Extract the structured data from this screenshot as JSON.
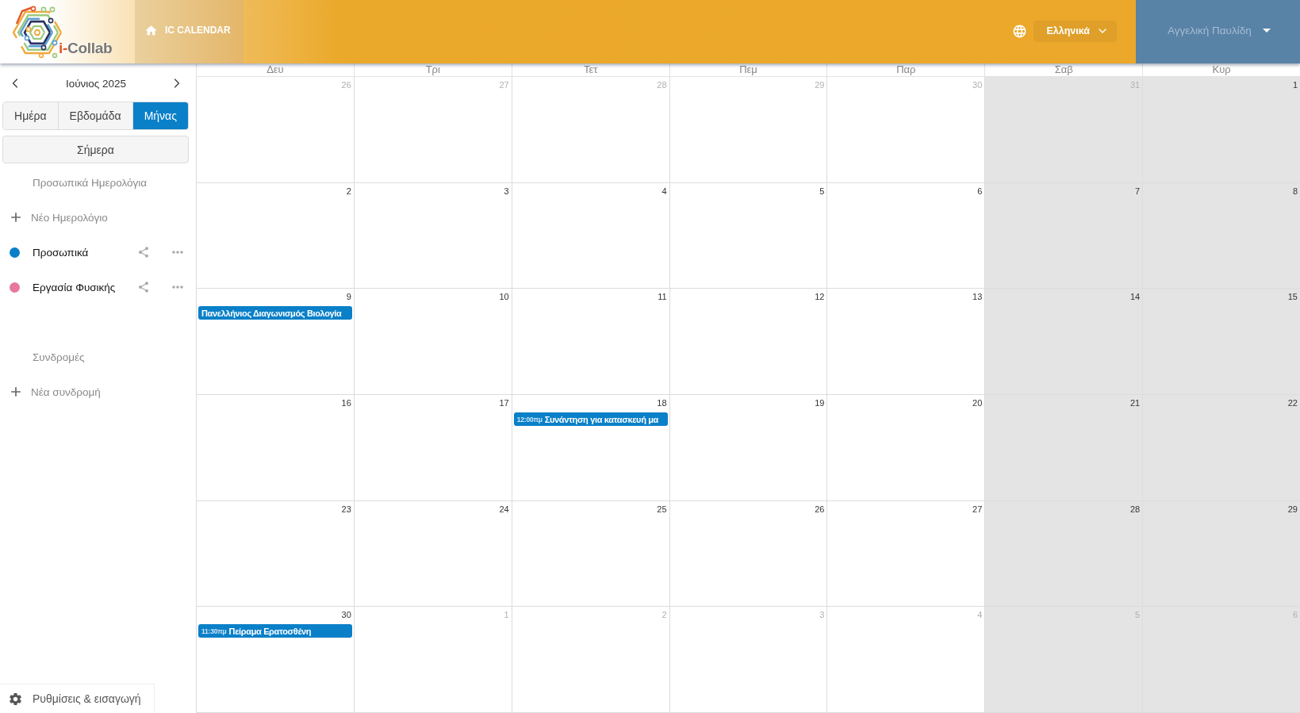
{
  "header": {
    "logo": {
      "prefix": "i-",
      "name": "Collab"
    },
    "app_title": "IC CALENDAR",
    "language": "Ελληνικά",
    "user": "Αγγελική Παυλίδη"
  },
  "sidebar": {
    "month": "Ιούνιος 2025",
    "views": [
      {
        "label": "Ημέρα",
        "selected": false
      },
      {
        "label": "Εβδομάδα",
        "selected": false
      },
      {
        "label": "Μήνας",
        "selected": true
      }
    ],
    "today": "Σήμερα",
    "sections": [
      {
        "title": "Προσωπικά Ημερολόγια",
        "add_label": "Νέο Ημερολόγιο",
        "calendars": [
          {
            "name": "Προσωπικά",
            "color": "#0a7fc8"
          },
          {
            "name": "Εργασία Φυσικής",
            "color": "#e8779f"
          }
        ]
      },
      {
        "title": "Συνδρομές",
        "add_label": "Νέα συνδρομή"
      }
    ],
    "settings": "Ρυθμίσεις & εισαγωγή"
  },
  "calendar": {
    "weekdays": [
      {
        "label": "Δευ",
        "weekend": false
      },
      {
        "label": "Τρι",
        "weekend": false
      },
      {
        "label": "Τετ",
        "weekend": false
      },
      {
        "label": "Πεμ",
        "weekend": false
      },
      {
        "label": "Παρ",
        "weekend": false
      },
      {
        "label": "Σαβ",
        "weekend": true
      },
      {
        "label": "Κυρ",
        "weekend": true
      }
    ],
    "weeks": [
      {
        "days": [
          {
            "day": "26",
            "outside": true
          },
          {
            "day": "27",
            "outside": true
          },
          {
            "day": "28",
            "outside": true
          },
          {
            "day": "29",
            "outside": true
          },
          {
            "day": "30",
            "outside": true
          },
          {
            "day": "31",
            "outside": true
          },
          {
            "day": "1",
            "outside": false
          }
        ]
      },
      {
        "days": [
          {
            "day": "2",
            "outside": false
          },
          {
            "day": "3",
            "outside": false
          },
          {
            "day": "4",
            "outside": false
          },
          {
            "day": "5",
            "outside": false
          },
          {
            "day": "6",
            "outside": false
          },
          {
            "day": "7",
            "outside": false
          },
          {
            "day": "8",
            "outside": false
          }
        ]
      },
      {
        "days": [
          {
            "day": "9",
            "outside": false,
            "events": [
              {
                "title": "Πανελλήνιος Διαγωνισμός Βιολογία"
              }
            ]
          },
          {
            "day": "10",
            "outside": false
          },
          {
            "day": "11",
            "outside": false
          },
          {
            "day": "12",
            "outside": false
          },
          {
            "day": "13",
            "outside": false
          },
          {
            "day": "14",
            "outside": false
          },
          {
            "day": "15",
            "outside": false
          }
        ]
      },
      {
        "days": [
          {
            "day": "16",
            "outside": false
          },
          {
            "day": "17",
            "outside": false
          },
          {
            "day": "18",
            "outside": false,
            "events": [
              {
                "time": "12:00πμ",
                "title": "Συνάντηση για κατασκευή μα"
              }
            ]
          },
          {
            "day": "19",
            "outside": false
          },
          {
            "day": "20",
            "outside": false
          },
          {
            "day": "21",
            "outside": false
          },
          {
            "day": "22",
            "outside": false
          }
        ]
      },
      {
        "days": [
          {
            "day": "23",
            "outside": false
          },
          {
            "day": "24",
            "outside": false
          },
          {
            "day": "25",
            "outside": false
          },
          {
            "day": "26",
            "outside": false
          },
          {
            "day": "27",
            "outside": false
          },
          {
            "day": "28",
            "outside": false
          },
          {
            "day": "29",
            "outside": false
          }
        ]
      },
      {
        "days": [
          {
            "day": "30",
            "outside": false,
            "events": [
              {
                "time": "11:30πμ",
                "title": "Πείραμα Ερατοσθένη"
              }
            ]
          },
          {
            "day": "1",
            "outside": true
          },
          {
            "day": "2",
            "outside": true
          },
          {
            "day": "3",
            "outside": true
          },
          {
            "day": "4",
            "outside": true
          },
          {
            "day": "5",
            "outside": true
          },
          {
            "day": "6",
            "outside": true
          }
        ]
      }
    ]
  }
}
